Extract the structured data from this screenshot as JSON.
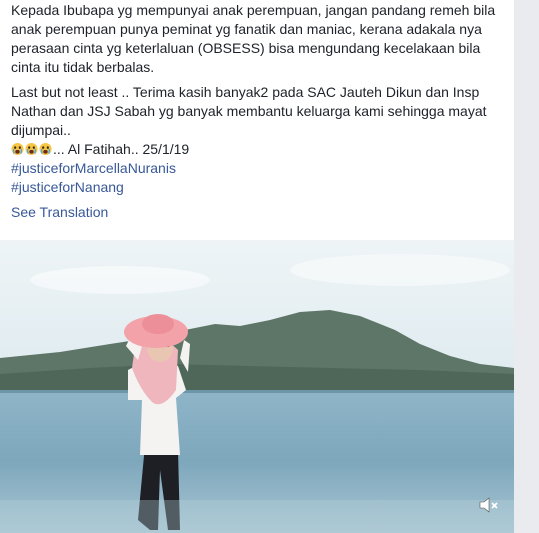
{
  "post": {
    "paragraphs": [
      "Kepada Ibubapa yg mempunyai anak perempuan, jangan pandang remeh bila anak perempuan punya peminat yg fanatik dan maniac, kerana adakala nya perasaan cinta yg keterlaluan (OBSESS) bisa mengundang kecelakaan bila cinta itu tidak berbalas.",
      "Last but not least .. Terima kasih banyak2 pada SAC Jauteh Dikun dan Insp Nathan dan JSJ Sabah yg banyak membantu keluarga kami sehingga mayat dijumpai..",
      "... Al Fatihah.. 25/1/19"
    ],
    "emoji_icons": [
      "crying-face-icon",
      "crying-face-icon",
      "crying-face-icon"
    ],
    "hashtags": [
      "#justiceforMarcellaNuranis",
      "#justiceforNanang"
    ],
    "see_translation": "See Translation"
  },
  "video": {
    "mute_icon": "speaker-muted-icon",
    "colors": {
      "sky": "#d6e7ef",
      "sea": "#7fa9bf",
      "hills": "#5d7466",
      "hat": "#f2a2a8"
    }
  }
}
